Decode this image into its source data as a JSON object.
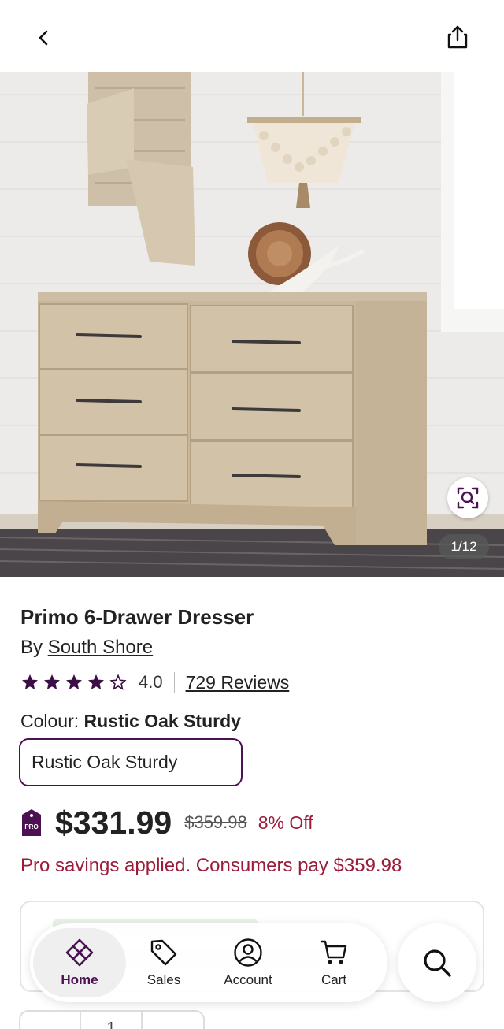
{
  "header": {
    "back_icon": "chevron-left-icon",
    "share_icon": "share-icon"
  },
  "gallery": {
    "counter": "1/12",
    "zoom_icon": "image-search-icon"
  },
  "product": {
    "title": "Primo 6-Drawer Dresser",
    "by_prefix": "By",
    "brand": "South Shore",
    "rating": 4.0,
    "rating_text": "4.0",
    "reviews_text": "729 Reviews",
    "colour_label": "Colour:",
    "colour_value": "Rustic Oak Sturdy",
    "selected_swatch": "Rustic Oak Sturdy",
    "price": "$331.99",
    "old_price": "$359.98",
    "discount": "8% Off",
    "pro_badge_text": "PRO",
    "pro_savings": "Pro savings applied. Consumers pay $359.98"
  },
  "quantity": {
    "value": "1"
  },
  "nav": {
    "items": [
      {
        "label": "Home",
        "icon": "home-icon",
        "active": true
      },
      {
        "label": "Sales",
        "icon": "tag-icon",
        "active": false
      },
      {
        "label": "Account",
        "icon": "account-icon",
        "active": false
      },
      {
        "label": "Cart",
        "icon": "cart-icon",
        "active": false
      }
    ],
    "search_icon": "search-icon"
  },
  "colors": {
    "brand_purple": "#4b1153",
    "sale_red": "#9b1c3a",
    "star": "#3b0f45"
  }
}
